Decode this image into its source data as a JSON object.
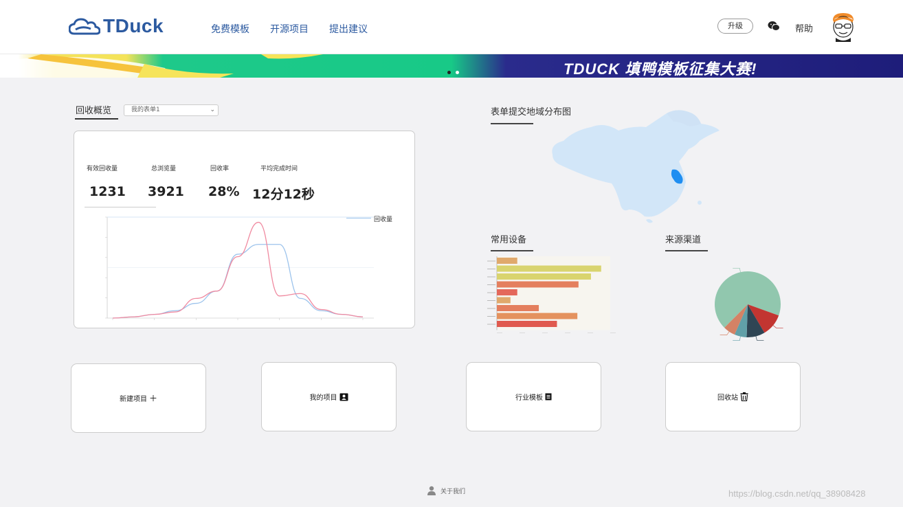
{
  "header": {
    "logo_text": "TDuck",
    "nav": [
      "免费模板",
      "开源项目",
      "提出建议"
    ],
    "upgrade_label": "升级",
    "help_label": "帮助"
  },
  "banner": {
    "title": "TDUCK 填鸭模板征集大赛!",
    "slide_count": 2,
    "active_slide": 2
  },
  "overview": {
    "tab_title": "回收概览",
    "selected_form": "我的表单1",
    "stats": [
      {
        "label": "有效回收量",
        "value": "1231"
      },
      {
        "label": "总浏览量",
        "value": "3921"
      },
      {
        "label": "回收率",
        "value": "28%"
      },
      {
        "label": "平均完成时间",
        "value": "12分12秒"
      }
    ],
    "legend": "回收量"
  },
  "right": {
    "map_title": "表单提交地域分布图",
    "devices_title": "常用设备",
    "channels_title": "来源渠道"
  },
  "actions": [
    {
      "label": "新建项目",
      "icon": "plus-icon",
      "glyph": "＋"
    },
    {
      "label": "我的项目",
      "icon": "contact-card-icon",
      "glyph": "▣"
    },
    {
      "label": "行业模板",
      "icon": "document-icon",
      "glyph": "▤"
    },
    {
      "label": "回收站",
      "icon": "trash-icon",
      "glyph": "🗑"
    }
  ],
  "footer": {
    "about_label": "关于我们",
    "watermark": "https://blog.csdn.net/qq_38908428"
  },
  "chart_data": [
    {
      "type": "line",
      "series": [
        {
          "name": "回收量",
          "color": "#9cc3ec",
          "values": [
            0,
            5,
            15,
            30,
            60,
            110,
            260,
            300,
            300,
            80,
            30,
            15,
            5
          ]
        },
        {
          "values": [
            0,
            5,
            15,
            25,
            80,
            110,
            250,
            390,
            90,
            100,
            35,
            15,
            5
          ],
          "color": "#f08aa0"
        }
      ]
    },
    {
      "type": "bar",
      "orientation": "horizontal",
      "values": [
        18,
        92,
        83,
        72,
        18,
        12,
        37,
        71,
        53
      ],
      "colors": [
        "#e0a96c",
        "#d9d46e",
        "#d9d46e",
        "#e47f5e",
        "#e4685b",
        "#e0a96c",
        "#e47f5e",
        "#e4925e",
        "#e05a4e"
      ]
    },
    {
      "type": "pie",
      "values": [
        68,
        11,
        9,
        6,
        6
      ],
      "colors": [
        "#91c7ae",
        "#c23531",
        "#2f4554",
        "#61a0a8",
        "#d48265"
      ]
    }
  ]
}
